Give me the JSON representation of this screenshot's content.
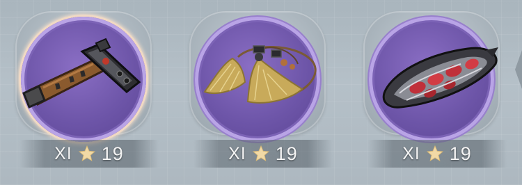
{
  "items": [
    {
      "icon": "war-hammer-icon",
      "tier": "XI",
      "level": "19",
      "selected": true
    },
    {
      "icon": "tassel-charm-icon",
      "tier": "XI",
      "level": "19",
      "selected": false
    },
    {
      "icon": "crimson-claw-icon",
      "tier": "XI",
      "level": "19",
      "selected": false
    }
  ],
  "colors": {
    "slot_purple": "#6d55a8",
    "star_gold": "#f1d9a6",
    "selected_glow": "#f1d9c3"
  }
}
